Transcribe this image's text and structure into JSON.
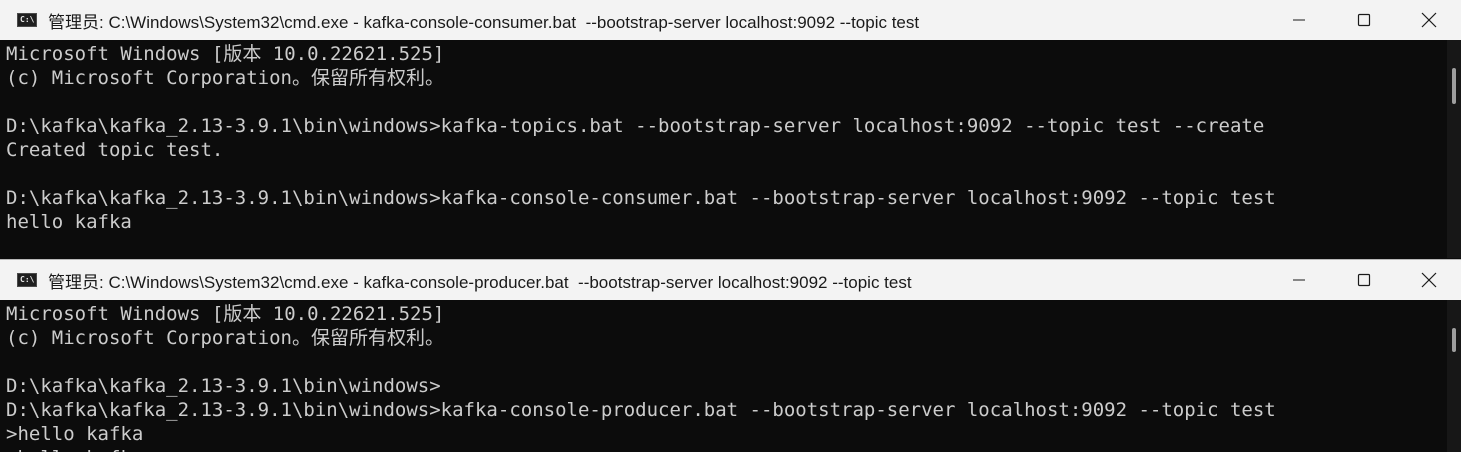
{
  "consumer_window": {
    "icon_label": "C:\\",
    "title": "管理员: C:\\Windows\\System32\\cmd.exe - kafka-console-consumer.bat  --bootstrap-server localhost:9092 --topic test",
    "lines": [
      "Microsoft Windows [版本 10.0.22621.525]",
      "(c) Microsoft Corporation。保留所有权利。",
      "",
      "D:\\kafka\\kafka_2.13-3.9.1\\bin\\windows>kafka-topics.bat --bootstrap-server localhost:9092 --topic test --create",
      "Created topic test.",
      "",
      "D:\\kafka\\kafka_2.13-3.9.1\\bin\\windows>kafka-console-consumer.bat --bootstrap-server localhost:9092 --topic test",
      "hello kafka"
    ]
  },
  "producer_window": {
    "icon_label": "C:\\",
    "title": "管理员: C:\\Windows\\System32\\cmd.exe - kafka-console-producer.bat  --bootstrap-server localhost:9092 --topic test",
    "lines": [
      "Microsoft Windows [版本 10.0.22621.525]",
      "(c) Microsoft Corporation。保留所有权利。",
      "",
      "D:\\kafka\\kafka_2.13-3.9.1\\bin\\windows>",
      "D:\\kafka\\kafka_2.13-3.9.1\\bin\\windows>kafka-console-producer.bat --bootstrap-server localhost:9092 --topic test",
      ">hello kafka",
      ">hello kafka"
    ]
  },
  "colors": {
    "console_bg": "#0c0c0c",
    "console_text": "#cccccc",
    "titlebar_bg": "#f3f3f3"
  }
}
